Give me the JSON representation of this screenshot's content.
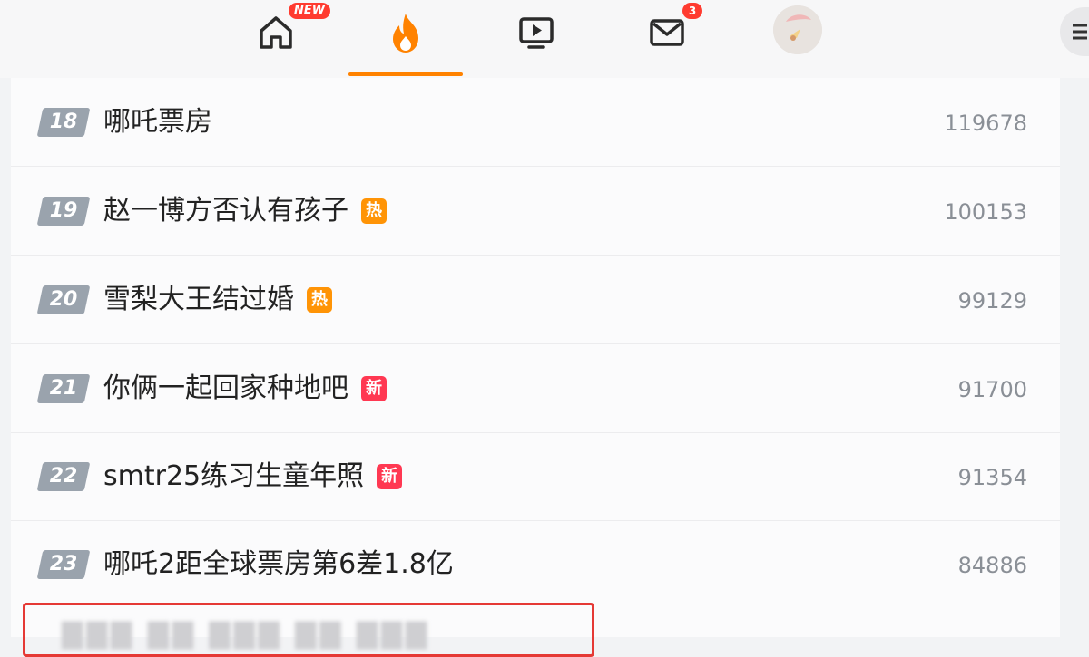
{
  "nav": {
    "home_badge": "NEW",
    "messages_badge": "3",
    "accent_color": "#ff8200"
  },
  "items": [
    {
      "rank": "18",
      "title": "哪吒票房",
      "tag": "",
      "tag_type": "",
      "count": "119678"
    },
    {
      "rank": "19",
      "title": "赵一博方否认有孩子",
      "tag": "热",
      "tag_type": "hot",
      "count": "100153"
    },
    {
      "rank": "20",
      "title": "雪梨大王结过婚",
      "tag": "热",
      "tag_type": "hot",
      "count": "99129"
    },
    {
      "rank": "21",
      "title": "你俩一起回家种地吧",
      "tag": "新",
      "tag_type": "new",
      "count": "91700"
    },
    {
      "rank": "22",
      "title": "smtr25练习生童年照",
      "tag": "新",
      "tag_type": "new",
      "count": "91354"
    },
    {
      "rank": "23",
      "title": "哪吒2距全球票房第6差1.8亿",
      "tag": "",
      "tag_type": "",
      "count": "84886"
    }
  ],
  "icons": {
    "home": "home-icon",
    "hot": "flame-icon",
    "video": "video-play-icon",
    "messages": "mail-icon",
    "menu": "menu-icon"
  }
}
